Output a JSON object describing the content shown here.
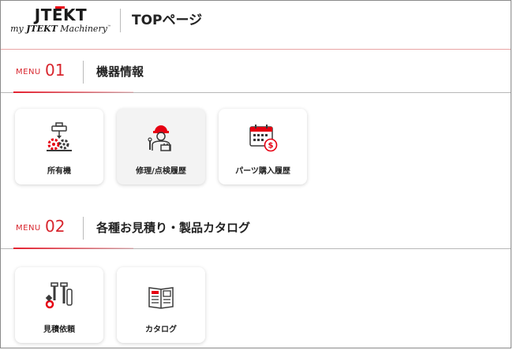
{
  "logo": {
    "brand": "JTEKT",
    "sub_prefix": "my ",
    "sub_brand": "JTEKT",
    "sub_suffix": " Machinery",
    "tm": "™"
  },
  "page_title": "TOPページ",
  "sections": [
    {
      "menu_label": "MENU",
      "menu_number": "01",
      "title": "機器情報",
      "cards": [
        {
          "label": "所有機",
          "icon": "machine-gear-icon"
        },
        {
          "label": "修理/点検履歴",
          "icon": "repair-worker-icon"
        },
        {
          "label": "パーツ購入履歴",
          "icon": "calendar-purchase-icon"
        }
      ]
    },
    {
      "menu_label": "MENU",
      "menu_number": "02",
      "title": "各種お見積り・製品カタログ",
      "cards": [
        {
          "label": "見積依頼",
          "icon": "parts-bolts-icon"
        },
        {
          "label": "カタログ",
          "icon": "catalog-book-icon"
        }
      ]
    }
  ],
  "colors": {
    "accent": "#d8262e",
    "icon_dark": "#3a3a3a",
    "card_active_bg": "#f3f3f3"
  }
}
